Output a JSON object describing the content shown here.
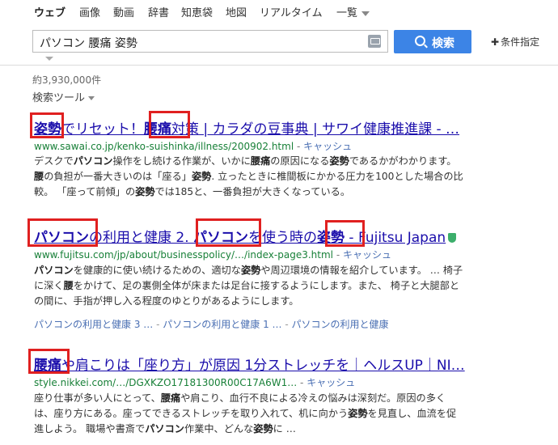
{
  "tabs": [
    {
      "label": "ウェブ",
      "active": true
    },
    {
      "label": "画像"
    },
    {
      "label": "動画"
    },
    {
      "label": "辞書"
    },
    {
      "label": "知恵袋"
    },
    {
      "label": "地図"
    },
    {
      "label": "リアルタイム"
    },
    {
      "label": "一覧"
    }
  ],
  "search": {
    "query": "パソコン 腰痛 姿勢",
    "button_label": "検索",
    "advanced_label": "条件指定"
  },
  "result_count": "約3,930,000件",
  "tools_label": "検索ツール",
  "results": [
    {
      "title_parts": [
        "姿勢",
        "でリセット！",
        "腰痛",
        "対策 | カラダの豆事典 | サワイ健康推進課 - …"
      ],
      "url": "www.sawai.co.jp/kenko-suishinka/illness/200902.html",
      "sep": "-",
      "cache": "キャッシュ",
      "snippet": [
        [
          "デスクで",
          "パソコン",
          "操作をし続ける作業が、いかに",
          "腰痛",
          "の原因になる",
          "姿勢",
          "であるかがわかります。"
        ],
        [
          "腰",
          "の負担が一番大きいのは「座る」",
          "姿勢",
          ". 立ったときに椎間板にかかる圧力を100とした場合の比"
        ],
        [
          "較。 「座って前傾」の",
          "姿勢",
          "では185と、一番負担が大きくなっている。"
        ]
      ]
    },
    {
      "title_parts": [
        "パソコン",
        "の利用と健康 2. ",
        "パソコン",
        "を使う時の",
        "姿勢",
        " - Fujitsu Japan"
      ],
      "url": "www.fujitsu.com/jp/about/businesspolicy/…/index-page3.html",
      "sep": "-",
      "cache": "キャッシュ",
      "snippet": [
        [
          "パソコン",
          "を健康的に使い続けるための、適切な",
          "姿勢",
          "や周辺環境の情報を紹介しています。 … 椅子"
        ],
        [
          "に深く",
          "腰",
          "をかけて、足の裏側全体が床または足台に接するようにします。また、 椅子と大腿部と"
        ],
        [
          "の間に、手指が押し入る程度のゆとりがあるようにします。"
        ]
      ],
      "sublinks": [
        "パソコンの利用と健康 3 …",
        "パソコンの利用と健康 1 …",
        "パソコンの利用と健康"
      ]
    },
    {
      "title_parts": [
        "腰痛",
        "や肩こりは「座り方」が原因 1分ストレッチを｜ヘルスUP｜NI…"
      ],
      "url": "style.nikkei.com/…/DGXKZO17181300R00C17A6W1…",
      "sep": "-",
      "cache": "キャッシュ",
      "snippet": [
        [
          "座り仕事が多い人にとって、",
          "腰痛",
          "や肩こり、血行不良による冷えの悩みは深刻だ。原因の多く"
        ],
        [
          "は、座り方にある。座ってできるストレッチを取り入れて、机に向かう",
          "姿勢",
          "を見直し、血流を促"
        ],
        [
          "進しよう。 職場や書斎で",
          "パソコン",
          "作業中、どんな",
          "姿勢",
          "に …"
        ]
      ]
    }
  ]
}
